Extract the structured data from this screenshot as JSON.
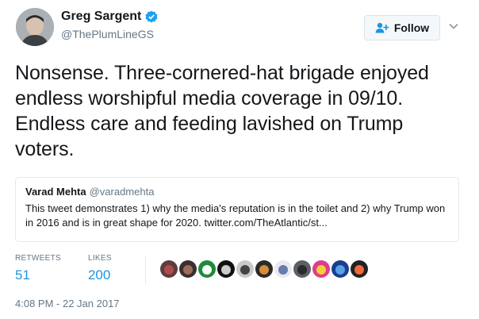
{
  "author": {
    "name": "Greg Sargent",
    "handle": "@ThePlumLineGS",
    "verified": true,
    "avatar_icon": "avatar-photo-icon"
  },
  "follow_button": {
    "label": "Follow",
    "icon": "add-user-icon"
  },
  "menu_icon": "chevron-down-icon",
  "tweet": {
    "text": "Nonsense. Three-cornered-hat brigade enjoyed endless worshipful media coverage in 09/10. Endless care and feeding lavished on Trump voters."
  },
  "quoted_tweet": {
    "name": "Varad Mehta",
    "handle": "@varadmehta",
    "text": "This tweet demonstrates 1) why the media's reputation is in the toilet and 2) why Trump won in 2016 and is in great shape for 2020. twitter.com/TheAtlantic/st..."
  },
  "stats": {
    "retweets_label": "RETWEETS",
    "retweets_value": "51",
    "likes_label": "LIKES",
    "likes_value": "200"
  },
  "likers": [
    {
      "name": "liker-1",
      "color": "#5a3d3d",
      "accent": "#b34a4a"
    },
    {
      "name": "liker-2",
      "color": "#3a2f2f",
      "accent": "#9c6b5e"
    },
    {
      "name": "liker-3",
      "color": "#1f8a3a",
      "accent": "#ffffff"
    },
    {
      "name": "liker-4",
      "color": "#111111",
      "accent": "#cccccc"
    },
    {
      "name": "liker-5",
      "color": "#c9c9c9",
      "accent": "#444444"
    },
    {
      "name": "liker-6",
      "color": "#2a2a2a",
      "accent": "#d98b3a"
    },
    {
      "name": "liker-7",
      "color": "#e9e9ef",
      "accent": "#6a7bb0"
    },
    {
      "name": "liker-8",
      "color": "#5b5f66",
      "accent": "#2b2b2b"
    },
    {
      "name": "liker-9",
      "color": "#e23a8e",
      "accent": "#f2d03a"
    },
    {
      "name": "liker-10",
      "color": "#1a3e8f",
      "accent": "#5aa0e6"
    },
    {
      "name": "liker-11",
      "color": "#222222",
      "accent": "#f06a3a"
    }
  ],
  "timestamp": "4:08 PM - 22 Jan 2017",
  "colors": {
    "link_blue": "#1b95e0",
    "muted": "#657786",
    "border": "#e1e8ed",
    "text": "#14171a"
  }
}
